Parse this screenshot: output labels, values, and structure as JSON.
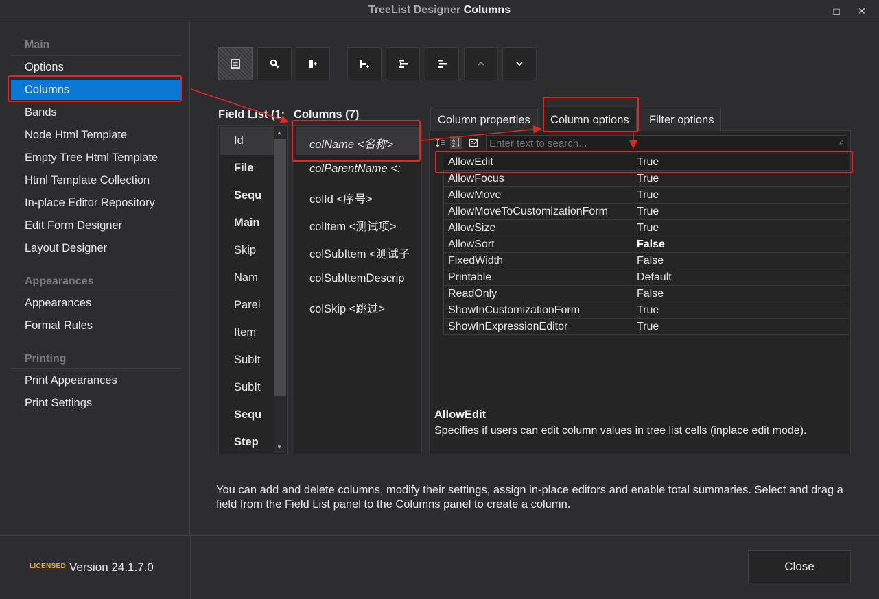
{
  "window": {
    "title_prefix": "TreeList Designer",
    "title_section": "Columns",
    "maximize_glyph": "◻",
    "close_glyph": "✕"
  },
  "sidebar": {
    "groups": [
      {
        "header": "Main",
        "items": [
          "Options",
          "Columns",
          "Bands",
          "Node Html Template",
          "Empty Tree Html Template",
          "Html Template Collection",
          "In-place Editor Repository",
          "Edit Form Designer",
          "Layout Designer"
        ]
      },
      {
        "header": "Appearances",
        "items": [
          "Appearances",
          "Format Rules"
        ]
      },
      {
        "header": "Printing",
        "items": [
          "Print Appearances",
          "Print Settings"
        ]
      }
    ],
    "active_item": "Columns"
  },
  "toolbar": {
    "buttons": [
      "show-field-list-icon",
      "search-icon",
      "retrieve-fields-icon",
      "add-column-icon",
      "insert-column-icon",
      "remove-column-icon",
      "move-up-icon",
      "move-down-icon"
    ]
  },
  "field_list": {
    "header": "Field List (1:",
    "items": [
      {
        "text": "Id",
        "bold": false
      },
      {
        "text": "File",
        "bold": true
      },
      {
        "text": "Sequ",
        "bold": true
      },
      {
        "text": "Main",
        "bold": true
      },
      {
        "text": "Skip",
        "bold": false
      },
      {
        "text": "Nam",
        "bold": false
      },
      {
        "text": "Parei",
        "bold": false
      },
      {
        "text": "Item",
        "bold": false
      },
      {
        "text": "SubIt",
        "bold": false
      },
      {
        "text": "SubIt",
        "bold": false
      },
      {
        "text": "Sequ",
        "bold": true
      },
      {
        "text": "Step",
        "bold": true
      }
    ]
  },
  "columns": {
    "header": "Columns (7)",
    "items": [
      {
        "text": "colName <名称>",
        "italic": true
      },
      {
        "text": "colParentName <:",
        "italic": true
      },
      {
        "text": "colId <序号>",
        "italic": false
      },
      {
        "text": "colItem <测试项>",
        "italic": false
      },
      {
        "text": "colSubItem <测试子",
        "italic": false
      },
      {
        "text": "colSubItemDescrip",
        "italic": false
      },
      {
        "text": "colSkip <跳过>",
        "italic": false
      }
    ]
  },
  "tabs": [
    "Column properties",
    "Column options",
    "Filter options"
  ],
  "active_tab": "Column options",
  "property_grid": {
    "search_placeholder": "Enter text to search...",
    "rows": [
      {
        "name": "AllowEdit",
        "value": "True",
        "bold": false
      },
      {
        "name": "AllowFocus",
        "value": "True",
        "bold": false
      },
      {
        "name": "AllowMove",
        "value": "True",
        "bold": false
      },
      {
        "name": "AllowMoveToCustomizationForm",
        "value": "True",
        "bold": false
      },
      {
        "name": "AllowSize",
        "value": "True",
        "bold": false
      },
      {
        "name": "AllowSort",
        "value": "False",
        "bold": true
      },
      {
        "name": "FixedWidth",
        "value": "False",
        "bold": false
      },
      {
        "name": "Printable",
        "value": "Default",
        "bold": false
      },
      {
        "name": "ReadOnly",
        "value": "False",
        "bold": false
      },
      {
        "name": "ShowInCustomizationForm",
        "value": "True",
        "bold": false
      },
      {
        "name": "ShowInExpressionEditor",
        "value": "True",
        "bold": false
      }
    ],
    "description_title": "AllowEdit",
    "description_text": "Specifies if users can edit column values in tree list cells (inplace edit mode)."
  },
  "help_text": "You can add and delete columns, modify their settings, assign in-place editors and enable total summaries. Select and drag a field from the Field List panel to the Columns panel to create a column.",
  "footer": {
    "licensed_badge": "LICENSED",
    "version": "Version 24.1.7.0",
    "close_label": "Close"
  },
  "colors": {
    "accent": "#0a78d4",
    "annotation": "#e8241f",
    "licensed": "#e8a33a"
  }
}
